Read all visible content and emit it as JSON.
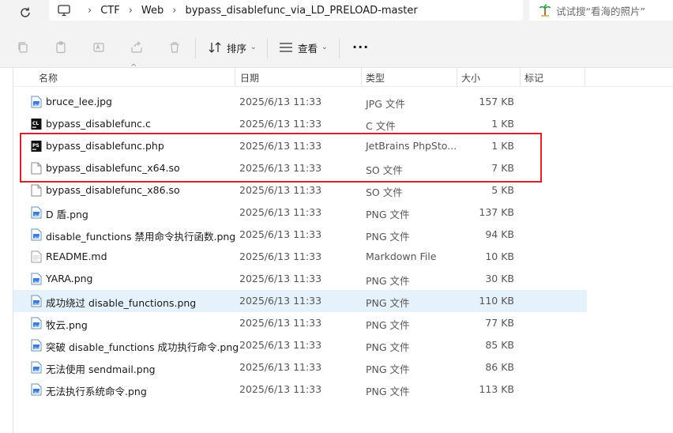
{
  "breadcrumb": {
    "items": [
      "CTF",
      "Web",
      "bypass_disablefunc_via_LD_PRELOAD-master"
    ]
  },
  "search": {
    "placeholder": "试试搜“看海的照片”"
  },
  "toolbar": {
    "sort_label": "排序",
    "view_label": "查看",
    "more_label": "···"
  },
  "columns": {
    "name": "名称",
    "date": "日期",
    "type": "类型",
    "size": "大小",
    "tag": "标记"
  },
  "files": [
    {
      "name": "bruce_lee.jpg",
      "date": "2025/6/13 11:33",
      "type": "JPG 文件",
      "size": "157 KB",
      "icon": "image-file-icon"
    },
    {
      "name": "bypass_disablefunc.c",
      "date": "2025/6/13 11:33",
      "type": "C 文件",
      "size": "1 KB",
      "icon": "clion-file-icon"
    },
    {
      "name": "bypass_disablefunc.php",
      "date": "2025/6/13 11:33",
      "type": "JetBrains PhpSto...",
      "size": "1 KB",
      "icon": "phpstorm-file-icon"
    },
    {
      "name": "bypass_disablefunc_x64.so",
      "date": "2025/6/13 11:33",
      "type": "SO 文件",
      "size": "7 KB",
      "icon": "blank-file-icon"
    },
    {
      "name": "bypass_disablefunc_x86.so",
      "date": "2025/6/13 11:33",
      "type": "SO 文件",
      "size": "5 KB",
      "icon": "blank-file-icon"
    },
    {
      "name": "D 盾.png",
      "date": "2025/6/13 11:33",
      "type": "PNG 文件",
      "size": "137 KB",
      "icon": "image-file-icon"
    },
    {
      "name": "disable_functions 禁用命令执行函数.png",
      "date": "2025/6/13 11:33",
      "type": "PNG 文件",
      "size": "94 KB",
      "icon": "image-file-icon"
    },
    {
      "name": "README.md",
      "date": "2025/6/13 11:33",
      "type": "Markdown File",
      "size": "10 KB",
      "icon": "markdown-file-icon"
    },
    {
      "name": "YARA.png",
      "date": "2025/6/13 11:33",
      "type": "PNG 文件",
      "size": "30 KB",
      "icon": "image-file-icon"
    },
    {
      "name": "成功绕过 disable_functions.png",
      "date": "2025/6/13 11:33",
      "type": "PNG 文件",
      "size": "110 KB",
      "icon": "image-file-icon"
    },
    {
      "name": "牧云.png",
      "date": "2025/6/13 11:33",
      "type": "PNG 文件",
      "size": "77 KB",
      "icon": "image-file-icon"
    },
    {
      "name": "突破 disable_functions 成功执行命令.png",
      "date": "2025/6/13 11:33",
      "type": "PNG 文件",
      "size": "85 KB",
      "icon": "image-file-icon"
    },
    {
      "name": "无法使用 sendmail.png",
      "date": "2025/6/13 11:33",
      "type": "PNG 文件",
      "size": "86 KB",
      "icon": "image-file-icon"
    },
    {
      "name": "无法执行系统命令.png",
      "date": "2025/6/13 11:33",
      "type": "PNG 文件",
      "size": "113 KB",
      "icon": "image-file-icon"
    }
  ],
  "selected_index": 9,
  "colors": {
    "highlight_border": "#d6222a",
    "selected_row": "#e5f1fb",
    "accent": "#1f6fc5"
  }
}
